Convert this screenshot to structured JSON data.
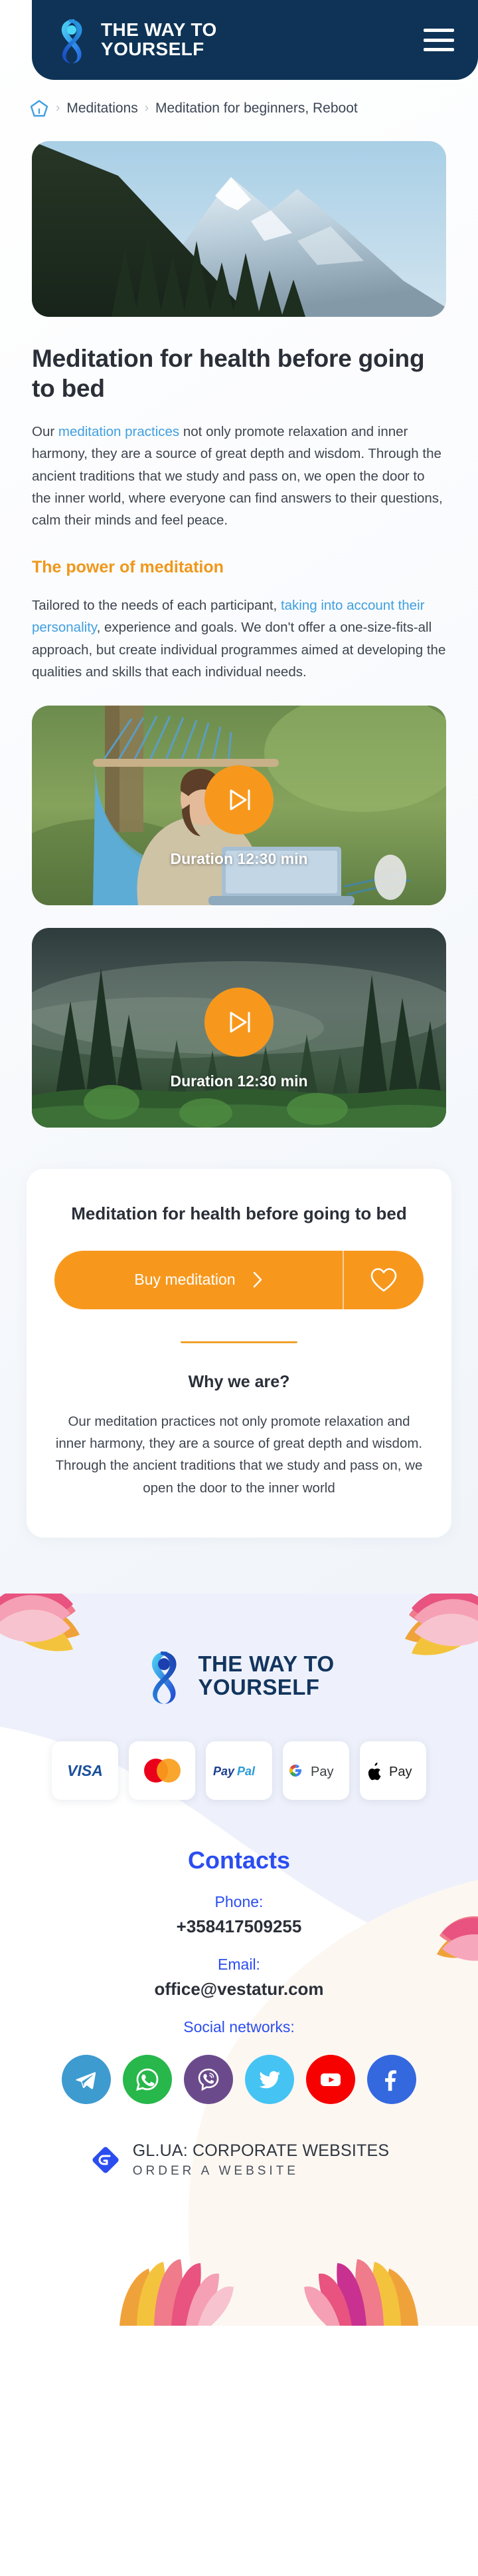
{
  "brand": {
    "line1": "THE WAY TO",
    "line2": "YOURSELF",
    "logo_icon": "ribbon-person-logo"
  },
  "header": {
    "menu_icon": "hamburger-menu-icon",
    "navy": "#0e3356"
  },
  "breadcrumb": {
    "home_icon": "home-icon",
    "separator": "›",
    "items": [
      {
        "label": "Meditations"
      },
      {
        "label": "Meditation for beginners, Reboot"
      }
    ]
  },
  "hero": {
    "alt": "snow-capped mountain with pine forest"
  },
  "article": {
    "title": "Meditation for health before going to bed",
    "paragraph1": {
      "before": "Our ",
      "link": "meditation practices",
      "after": " not only promote relaxation and inner harmony, they are a source of great depth and wisdom. Through the ancient traditions that we study and pass on, we open the door to the inner world, where everyone can find answers to their questions, calm their minds and feel peace."
    },
    "subheading": "The power of meditation",
    "paragraph2": {
      "before": "Tailored to the needs of each participant, ",
      "link": "taking into account their personality",
      "after": ", experience and goals. We don't offer a one-size-fits-all approach, but create individual programmes aimed at developing the qualities and skills that each individual needs."
    }
  },
  "videos": [
    {
      "alt": "man relaxing in a blue hammock with laptop",
      "play_icon": "play-next-icon",
      "duration": "Duration 12:30 min"
    },
    {
      "alt": "misty pine forest valley",
      "play_icon": "play-next-icon",
      "duration": "Duration 12:30 min"
    }
  ],
  "buy_card": {
    "title": "Meditation for health before going to bed",
    "buy_label": "Buy meditation",
    "chevron_icon": "chevron-right-icon",
    "favorite_icon": "heart-outline-icon",
    "why_title": "Why we are?",
    "why_text": "Our meditation practices not only promote relaxation and inner harmony, they are a source of great depth and wisdom. Through the ancient traditions that we study and pass on, we open the door to the inner world",
    "accent": "#f7981d"
  },
  "footer": {
    "payments": [
      {
        "name": "VISA",
        "icon": "visa-icon"
      },
      {
        "name": "Mastercard",
        "icon": "mastercard-icon"
      },
      {
        "name": "PayPal",
        "icon": "paypal-icon"
      },
      {
        "name": "G Pay",
        "icon": "google-pay-icon"
      },
      {
        "name": "Apple Pay",
        "icon": "apple-pay-icon"
      }
    ],
    "contacts_title": "Contacts",
    "phone_label": "Phone:",
    "phone_value": "+358417509255",
    "email_label": "Email:",
    "email_value": "office@vestatur.com",
    "social_label": "Social networks:",
    "socials": [
      {
        "name": "Telegram",
        "icon": "telegram-icon",
        "color": "#3d9bd0"
      },
      {
        "name": "WhatsApp",
        "icon": "whatsapp-icon",
        "color": "#27b74a"
      },
      {
        "name": "Viber",
        "icon": "viber-icon",
        "color": "#6b4a8c"
      },
      {
        "name": "Twitter",
        "icon": "twitter-icon",
        "color": "#45c4f4"
      },
      {
        "name": "YouTube",
        "icon": "youtube-icon",
        "color": "#f60000"
      },
      {
        "name": "Facebook",
        "icon": "facebook-icon",
        "color": "#3368df"
      }
    ],
    "credit_main": "GL.UA: CORPORATE WEBSITES",
    "credit_sub": "ORDER A WEBSITE",
    "credit_icon": "gl-ua-logo-icon",
    "contacts_accent": "#2b4df0"
  }
}
